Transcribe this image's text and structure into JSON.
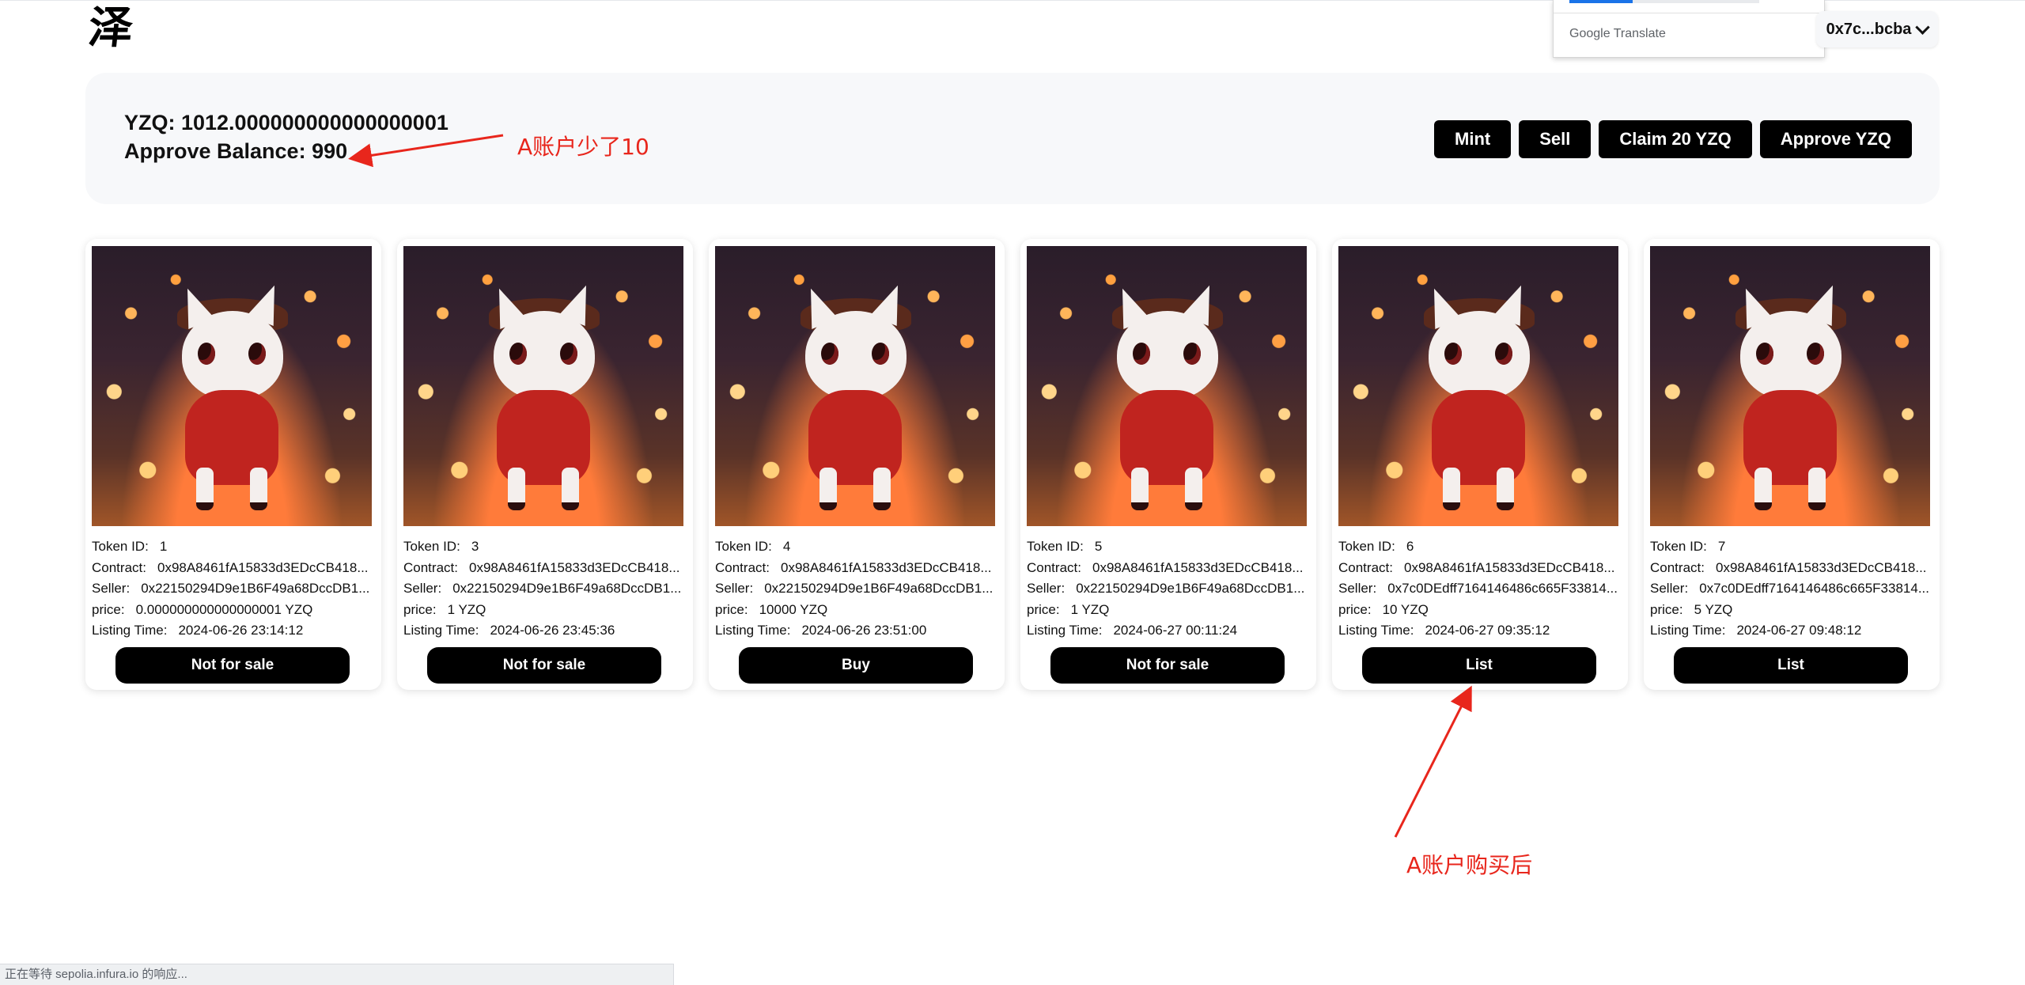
{
  "logo": {
    "text": "泽"
  },
  "translate_popup": {
    "brand_google": "Google",
    "brand_translate": "Translate"
  },
  "account": {
    "label": "0x7c...bcba"
  },
  "balances": {
    "yzq": "YZQ: 1012.000000000000000001",
    "approve": "Approve Balance: 990"
  },
  "actions": {
    "mint": "Mint",
    "sell": "Sell",
    "claim": "Claim 20 YZQ",
    "approve": "Approve YZQ"
  },
  "annotations": {
    "balance_note": "A账户少了10",
    "after_buy_note": "A账户购买后"
  },
  "labels": {
    "token_id": "Token ID:",
    "contract": "Contract:",
    "seller": "Seller:",
    "price": "price:",
    "listing_time": "Listing Time:"
  },
  "cards": [
    {
      "token_id": "1",
      "contract": "0x98A8461fA15833d3EDcCB418...",
      "seller": "0x22150294D9e1B6F49a68DccDB1...",
      "price": "0.000000000000000001 YZQ",
      "listing_time": "2024-06-26 23:14:12",
      "action": "Not for sale"
    },
    {
      "token_id": "3",
      "contract": "0x98A8461fA15833d3EDcCB418...",
      "seller": "0x22150294D9e1B6F49a68DccDB1...",
      "price": "1 YZQ",
      "listing_time": "2024-06-26 23:45:36",
      "action": "Not for sale"
    },
    {
      "token_id": "4",
      "contract": "0x98A8461fA15833d3EDcCB418...",
      "seller": "0x22150294D9e1B6F49a68DccDB1...",
      "price": "10000 YZQ",
      "listing_time": "2024-06-26 23:51:00",
      "action": "Buy"
    },
    {
      "token_id": "5",
      "contract": "0x98A8461fA15833d3EDcCB418...",
      "seller": "0x22150294D9e1B6F49a68DccDB1...",
      "price": "1 YZQ",
      "listing_time": "2024-06-27 00:11:24",
      "action": "Not for sale"
    },
    {
      "token_id": "6",
      "contract": "0x98A8461fA15833d3EDcCB418...",
      "seller": "0x7c0DEdff7164146486c665F33814...",
      "price": "10 YZQ",
      "listing_time": "2024-06-27 09:35:12",
      "action": "List"
    },
    {
      "token_id": "7",
      "contract": "0x98A8461fA15833d3EDcCB418...",
      "seller": "0x7c0DEdff7164146486c665F33814...",
      "price": "5 YZQ",
      "listing_time": "2024-06-27 09:48:12",
      "action": "List"
    }
  ],
  "status_bar": {
    "text": "正在等待 sepolia.infura.io 的响应..."
  },
  "colors": {
    "accent": "#000000",
    "annotation": "#e8261c",
    "panel": "#f7f8fa"
  }
}
